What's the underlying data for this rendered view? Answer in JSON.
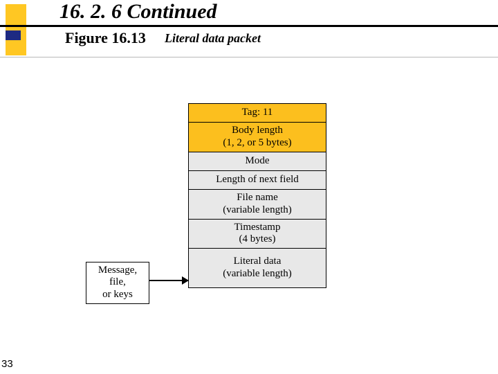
{
  "header": {
    "section": "16. 2. 6  Continued",
    "figure_label": "Figure 16.13",
    "figure_caption": "Literal data packet"
  },
  "packet": {
    "tag": {
      "line1": "Tag: 11"
    },
    "body_length": {
      "line1": "Body length",
      "line2": "(1, 2, or 5 bytes)"
    },
    "mode": {
      "line1": "Mode"
    },
    "next_len": {
      "line1": "Length of next field"
    },
    "file_name": {
      "line1": "File name",
      "line2": "(variable length)"
    },
    "timestamp": {
      "line1": "Timestamp",
      "line2": "(4 bytes)"
    },
    "literal_data": {
      "line1": "Literal data",
      "line2": "(variable length)"
    }
  },
  "input_box": {
    "line1": "Message,",
    "line2": "file,",
    "line3": "or keys"
  },
  "page_number": "33"
}
